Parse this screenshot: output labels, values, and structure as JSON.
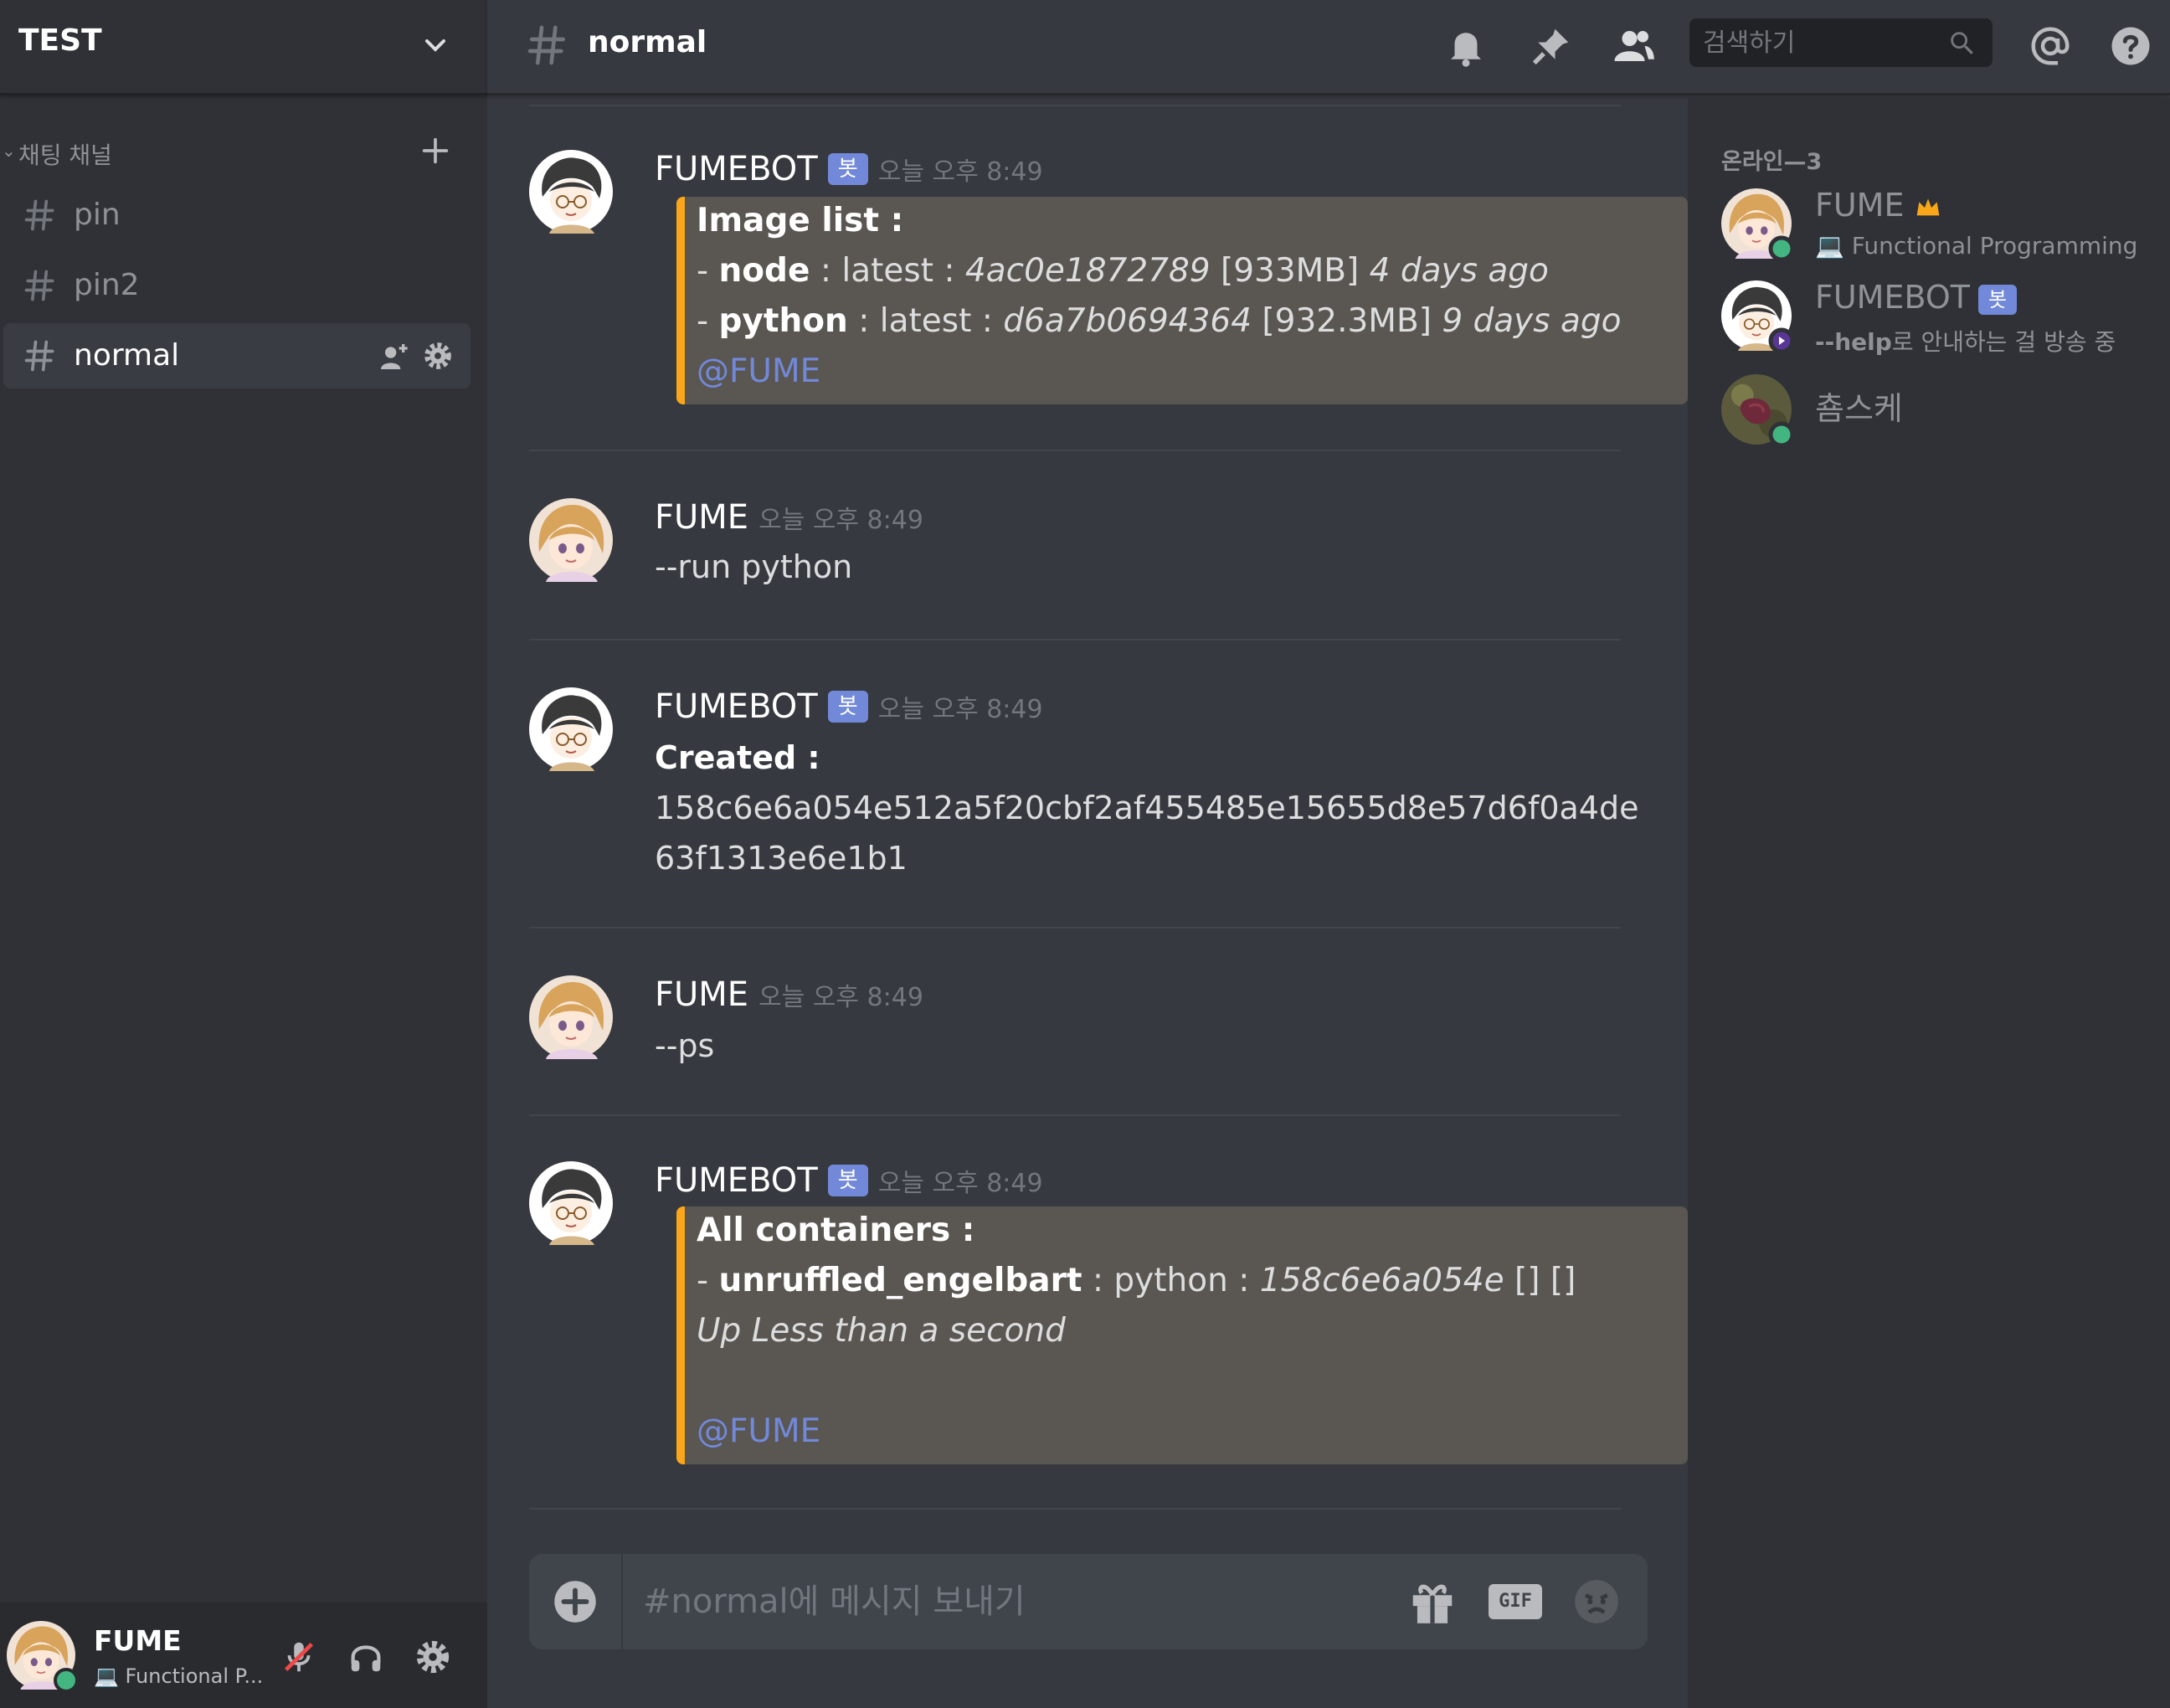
{
  "server": {
    "name": "TEST"
  },
  "category": {
    "label": "채팅 채널"
  },
  "channels": [
    {
      "name": "pin"
    },
    {
      "name": "pin2"
    },
    {
      "name": "normal"
    }
  ],
  "header": {
    "channel_name": "normal",
    "search_placeholder": "검색하기"
  },
  "messages": [
    {
      "author": "FUMEBOT",
      "bot": true,
      "bot_tag": "봇",
      "time": "오늘 오후 8:49",
      "embed": {
        "title": "Image list :",
        "rows": [
          {
            "dash": "- ",
            "name": "node",
            "sep": " : latest : ",
            "id": "4ac0e1872789",
            "size": " [933MB] ",
            "age": "4 days ago"
          },
          {
            "dash": "- ",
            "name": "python",
            "sep": " : latest : ",
            "id": "d6a7b0694364",
            "size": " [932.3MB] ",
            "age": "9 days ago"
          }
        ],
        "mention": "@FUME"
      }
    },
    {
      "author": "FUME",
      "time": "오늘 오후 8:49",
      "text": "--run python"
    },
    {
      "author": "FUMEBOT",
      "bot": true,
      "bot_tag": "봇",
      "time": "오늘 오후 8:49",
      "heading": "Created :",
      "lines": [
        "158c6e6a054e512a5f20cbf2af455485e15655d8e57d6f0a4de",
        "63f1313e6e1b1"
      ]
    },
    {
      "author": "FUME",
      "time": "오늘 오후 8:49",
      "text": "--ps"
    },
    {
      "author": "FUMEBOT",
      "bot": true,
      "bot_tag": "봇",
      "time": "오늘 오후 8:49",
      "embed": {
        "title": "All containers :",
        "row": {
          "dash": "- ",
          "name": "unruffled_engelbart",
          "sep": " : python : ",
          "id": "158c6e6a054e",
          "tail": " [] []"
        },
        "status": "Up Less than a second",
        "mention": "@FUME"
      }
    }
  ],
  "composer": {
    "placeholder": "#normal에 메시지 보내기",
    "gif_label": "GIF"
  },
  "members": {
    "header": "온라인—3",
    "list": [
      {
        "name": "FUME",
        "owner": true,
        "status": "Functional Programming",
        "presence": "online",
        "status_color": "#43b581"
      },
      {
        "name": "FUMEBOT",
        "bot": true,
        "bot_tag": "봇",
        "status_bold": "--help",
        "status_rest": "로 안내하는 걸 방송 중",
        "presence": "streaming",
        "status_color": "#593695"
      },
      {
        "name": "춈스케",
        "presence": "online",
        "status_color": "#43b581"
      }
    ]
  },
  "user_panel": {
    "name": "FUME",
    "status": "Functional P..."
  },
  "colors": {
    "accent": "#7289da",
    "embed_border": "#faa61a",
    "online": "#43b581",
    "streaming": "#593695"
  }
}
